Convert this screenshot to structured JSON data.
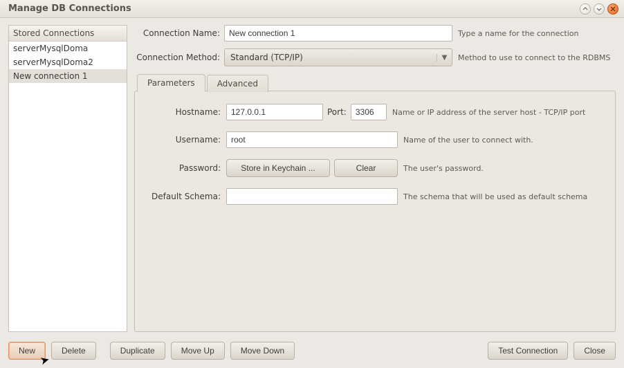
{
  "window": {
    "title": "Manage DB Connections"
  },
  "sidebar": {
    "header": "Stored Connections",
    "items": [
      {
        "label": "serverMysqlDoma"
      },
      {
        "label": "serverMysqlDoma2"
      },
      {
        "label": "New connection 1"
      }
    ],
    "selected_index": 2
  },
  "form": {
    "name_label": "Connection Name:",
    "name_value": "New connection 1",
    "name_hint": "Type a name for the connection",
    "method_label": "Connection Method:",
    "method_value": "Standard (TCP/IP)",
    "method_hint": "Method to use to connect to the RDBMS"
  },
  "tabs": {
    "parameters": "Parameters",
    "advanced": "Advanced"
  },
  "params": {
    "hostname_label": "Hostname:",
    "hostname_value": "127.0.0.1",
    "port_label": "Port:",
    "port_value": "3306",
    "hostname_hint": "Name or IP address of the server host - TCP/IP port",
    "username_label": "Username:",
    "username_value": "root",
    "username_hint": "Name of the user to connect with.",
    "password_label": "Password:",
    "password_store_btn": "Store in Keychain ...",
    "password_clear_btn": "Clear",
    "password_hint": "The user's password.",
    "schema_label": "Default Schema:",
    "schema_value": "",
    "schema_hint": "The schema that will be used as default schema"
  },
  "buttons": {
    "new": "New",
    "delete": "Delete",
    "duplicate": "Duplicate",
    "move_up": "Move Up",
    "move_down": "Move Down",
    "test": "Test Connection",
    "close": "Close"
  }
}
